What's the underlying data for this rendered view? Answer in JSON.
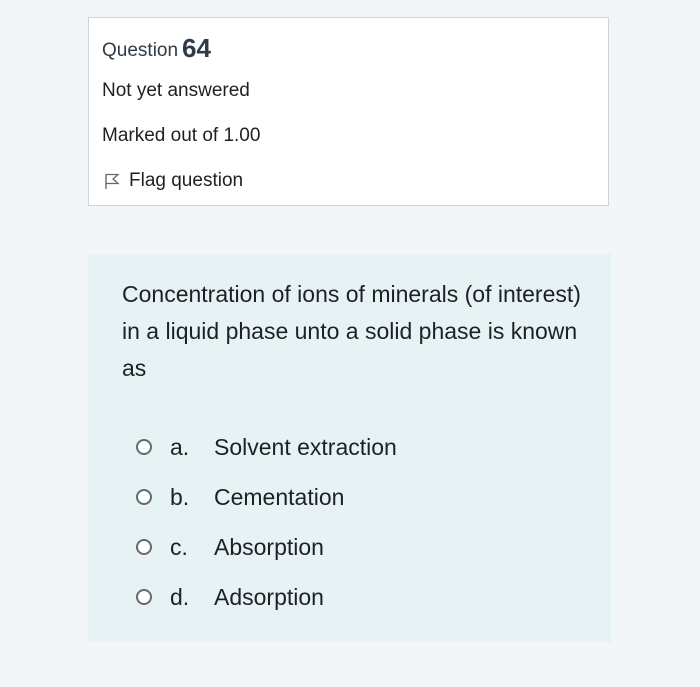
{
  "info": {
    "question_label": "Question",
    "question_number": "64",
    "state": "Not yet answered",
    "grade": "Marked out of 1.00",
    "flag_label": "Flag question",
    "flag_icon": "flag-icon"
  },
  "question": {
    "text": "Concentration of ions of minerals (of interest) in a liquid phase unto a solid phase is known as",
    "options": [
      {
        "letter": "a.",
        "label": "Solvent extraction",
        "selected": false
      },
      {
        "letter": "b.",
        "label": "Cementation",
        "selected": false
      },
      {
        "letter": "c.",
        "label": "Absorption",
        "selected": false
      },
      {
        "letter": "d.",
        "label": "Adsorption",
        "selected": false
      }
    ]
  },
  "colors": {
    "page_background": "#f2f6f9",
    "info_background": "#ffffff",
    "info_border": "#cfd4da",
    "formulation_background": "#e7f2f5",
    "text": "#1d2125"
  }
}
